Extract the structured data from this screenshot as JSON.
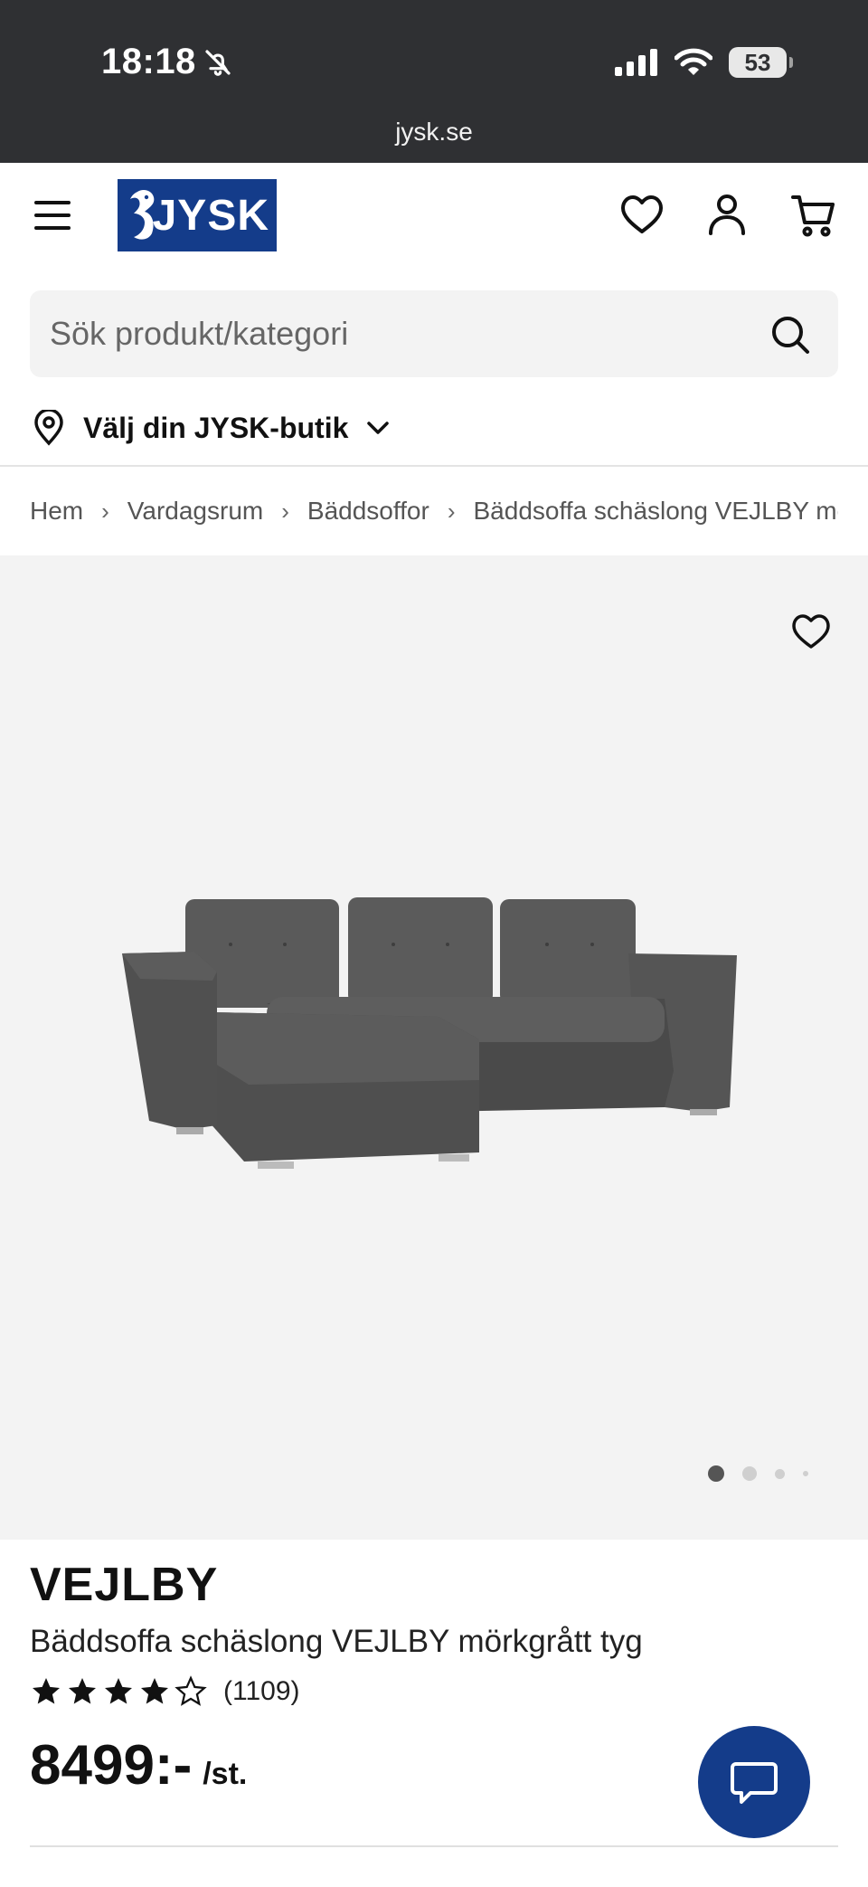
{
  "status_bar": {
    "time": "18:18",
    "battery": "53"
  },
  "browser": {
    "url": "jysk.se"
  },
  "header": {
    "logo_text": "JYSK"
  },
  "search": {
    "placeholder": "Sök produkt/kategori"
  },
  "store": {
    "label": "Välj din JYSK-butik"
  },
  "breadcrumb": {
    "items": [
      "Hem",
      "Vardagsrum",
      "Bäddsoffor",
      "Bäddsoffa schäslong VEJLBY mörk"
    ],
    "separator": "›"
  },
  "gallery": {
    "total_images": 4,
    "active_index": 0
  },
  "product": {
    "brand": "VEJLBY",
    "name": "Bäddsoffa schäslong VEJLBY mörkgrått tyg",
    "rating": 4,
    "rating_max": 5,
    "review_count": "(1109)",
    "price": "8499:-",
    "unit": "/st."
  },
  "colors": {
    "brand_blue": "#143c8a",
    "status_bar_bg": "#2f3033",
    "gallery_bg": "#f3f3f3"
  }
}
